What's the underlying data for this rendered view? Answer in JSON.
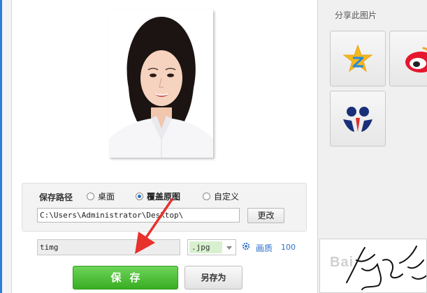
{
  "save_path": {
    "label": "保存路径",
    "options": [
      {
        "label": "桌面",
        "selected": false
      },
      {
        "label": "覆盖原图",
        "selected": true
      },
      {
        "label": "自定义",
        "selected": false
      }
    ],
    "path_value": "C:\\Users\\Administrator\\Desktop\\",
    "change_button": "更改"
  },
  "filename": {
    "value": "timg",
    "extension": ".jpg"
  },
  "quality": {
    "label": "画质",
    "value": "100"
  },
  "buttons": {
    "save": "保存",
    "save_as": "另存为"
  },
  "share": {
    "title": "分享此图片",
    "targets": [
      "qzone-icon",
      "weibo-icon",
      "tencent-weibo-icon"
    ]
  },
  "preview": {
    "watermark": "Bai"
  },
  "colors": {
    "accent_blue": "#2a6fc9",
    "save_green": "#39ad22",
    "annotation_red": "#e8312b"
  }
}
